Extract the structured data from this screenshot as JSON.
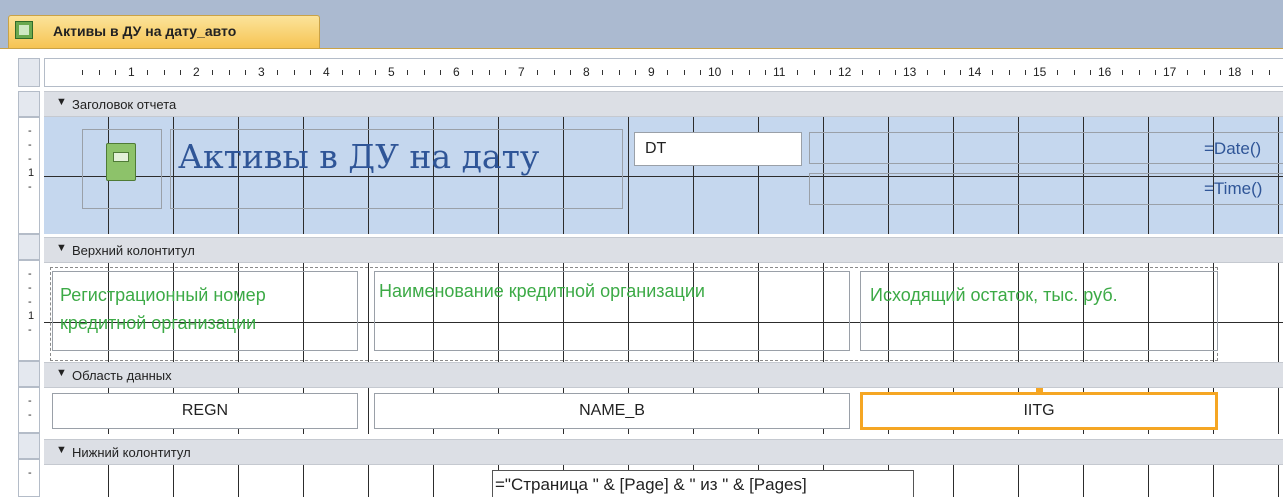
{
  "tab": {
    "title": "Активы в ДУ на дату_авто"
  },
  "ruler": {
    "numbers": [
      "1",
      "2",
      "3",
      "4",
      "5",
      "6",
      "7",
      "8",
      "9",
      "10",
      "11",
      "12",
      "13",
      "14",
      "15",
      "16",
      "17",
      "18"
    ],
    "vmark": "1"
  },
  "sections": {
    "report_header": {
      "label": "Заголовок отчета",
      "title": "Активы в ДУ на дату",
      "dt_field": "DT",
      "date_expr": "=Date()",
      "time_expr": "=Time()"
    },
    "page_header": {
      "label": "Верхний колонтитул",
      "col1_line1": "Регистрационный номер",
      "col1_line2": "кредитной организации",
      "col2": "Наименование кредитной организации",
      "col3": "Исходящий остаток, тыс. руб."
    },
    "detail": {
      "label": "Область данных",
      "regn": "REGN",
      "name_b": "NAME_B",
      "iitg": "IITG"
    },
    "page_footer": {
      "label": "Нижний колонтитул",
      "page_expr": "=\"Страница \" & [Page] & \" из \" & [Pages]"
    }
  },
  "colors": {
    "tab_bg": "#f6c453",
    "header_bg": "#c5d7ee",
    "title": "#2f5597",
    "green": "#3caa46",
    "selected": "#f5a623"
  }
}
